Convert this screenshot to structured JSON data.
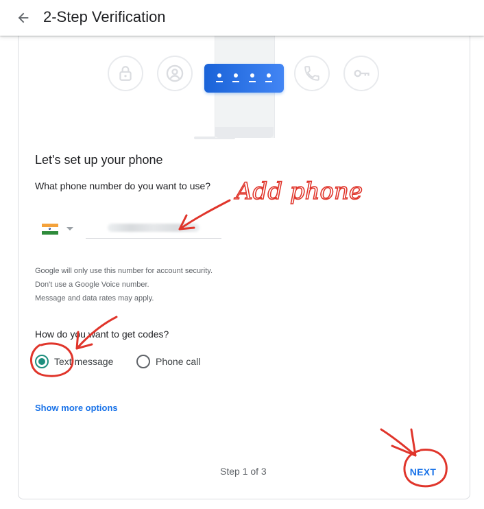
{
  "header": {
    "title": "2-Step Verification"
  },
  "setup": {
    "title": "Let's set up your phone",
    "question": "What phone number do you want to use?",
    "phone_value": "",
    "help_lines": [
      "Google will only use this number for account security.",
      "Don't use a Google Voice number.",
      "Message and data rates may apply."
    ]
  },
  "codes": {
    "question": "How do you want to get codes?",
    "options": [
      {
        "label": "Text message",
        "selected": true
      },
      {
        "label": "Phone call",
        "selected": false
      }
    ]
  },
  "links": {
    "show_more": "Show more options"
  },
  "footer": {
    "step": "Step 1 of 3",
    "next_label": "NEXT"
  },
  "annotations": {
    "add_phone": "Add phone"
  },
  "colors": {
    "accent": "#1a73e8",
    "radio_selected": "#1e8e7e",
    "annotation": "#e0352b"
  }
}
